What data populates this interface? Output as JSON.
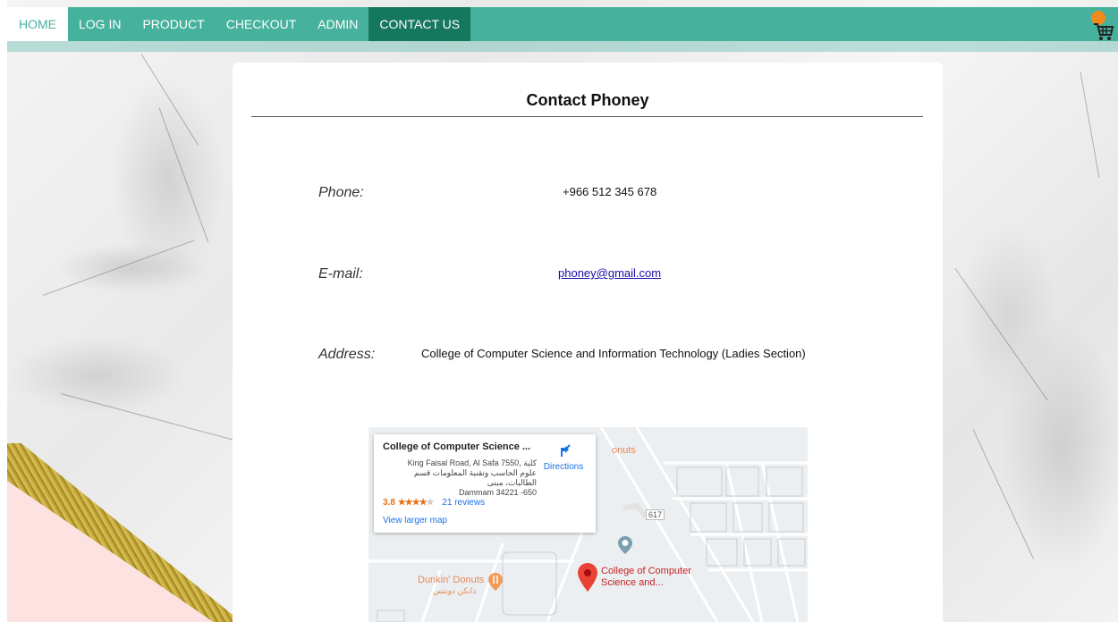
{
  "nav": {
    "items": [
      "HOME",
      "LOG IN",
      "PRODUCT",
      "CHECKOUT",
      "ADMIN",
      "CONTACT US"
    ],
    "active": "CONTACT US"
  },
  "cart": {
    "icon": "cart-icon"
  },
  "contact": {
    "title": "Contact Phoney",
    "phone_label": "Phone:",
    "phone_value": "+966 512 345 678",
    "email_label": "E-mail:",
    "email_value": "phoney@gmail.com",
    "address_label": "Address:",
    "address_value": "College of Computer Science and Information Technology (Ladies Section)"
  },
  "map": {
    "card_title": "College of Computer Science ...",
    "card_address_1": "King Faisal Road, Al Safa 7550, كلية",
    "card_address_2": "علوم الحاسب وتقنية المعلومات قسم الطالبات، مبنى",
    "card_address_3": "Dammam 34221 -650",
    "rating": "3.8",
    "stars": "★★★★",
    "star_empty": "★",
    "reviews": "21 reviews",
    "larger_map": "View larger map",
    "directions": "Directions",
    "place_donuts_top": "onuts",
    "road_number": "617",
    "place_dunkin": "Dunkin' Donuts",
    "place_dunkin_ar": "دانكن دونتس",
    "place_college_1": "College of Computer",
    "place_college_2": "Science and..."
  },
  "colors": {
    "nav": "#46b29d",
    "nav_active": "#16775f",
    "link": "#1a0dab",
    "pin": "#ea4335"
  }
}
